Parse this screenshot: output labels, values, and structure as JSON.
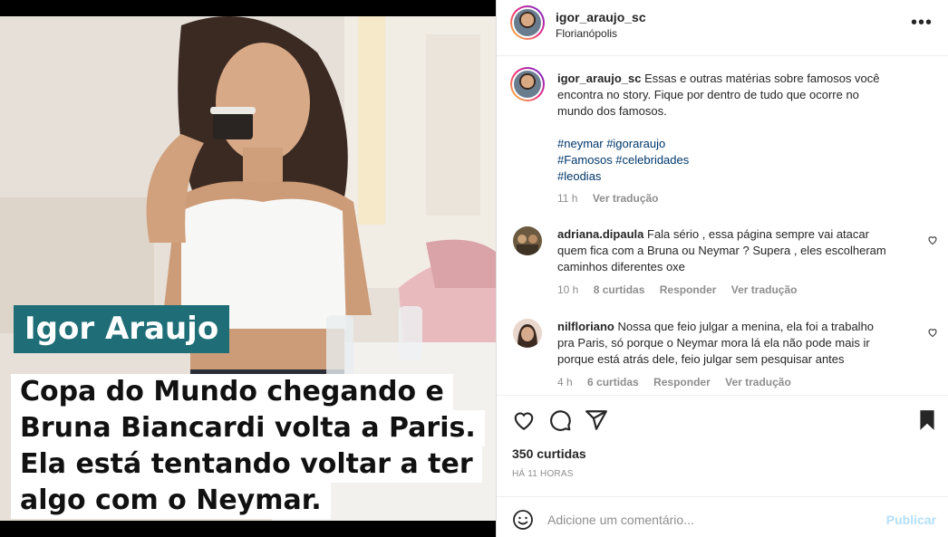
{
  "media": {
    "name_tag": "Igor Araujo",
    "caption_lines": [
      "Copa do Mundo chegando e",
      "Bruna Biancardi volta a Paris.",
      "Ela está tentando voltar a ter",
      "algo com o Neymar."
    ]
  },
  "header": {
    "username": "igor_araujo_sc",
    "location": "Florianópolis",
    "more_icon": "more-horizontal-icon"
  },
  "post_caption": {
    "username": "igor_araujo_sc",
    "text_lines": [
      "Essas e outras matérias sobre famosos você",
      "encontra no story. Fique por dentro de tudo que ocorre no",
      "mundo dos famosos."
    ],
    "hashtag_lines": [
      "#neymar #igoraraujo",
      "#Famosos #celebridades",
      "#leodias"
    ],
    "time": "11 h",
    "translate": "Ver tradução"
  },
  "comments": [
    {
      "username": "adriana.dipaula",
      "text_lines": [
        "Fala sério , essa página sempre vai atacar",
        "quem fica com a Bruna ou Neymar ? Supera , eles escolheram",
        "caminhos diferentes oxe"
      ],
      "time": "10 h",
      "likes": "8 curtidas",
      "reply": "Responder",
      "translate": "Ver tradução"
    },
    {
      "username": "nilfloriano",
      "text_lines": [
        "Nossa que feio julgar a menina, ela foi a trabalho",
        "pra Paris, só porque o Neymar mora lá ela não pode mais ir",
        "porque está atrás dele, feio julgar sem pesquisar antes"
      ],
      "time": "4 h",
      "likes": "6 curtidas",
      "reply": "Responder",
      "translate": "Ver tradução"
    }
  ],
  "actions": {
    "likes": "350 curtidas",
    "time_ago": "HÁ 11 HORAS",
    "icons": [
      "heart-icon",
      "comment-icon",
      "share-icon",
      "bookmark-icon"
    ]
  },
  "add_comment": {
    "placeholder": "Adicione um comentário...",
    "publish": "Publicar",
    "emoji_icon": "emoji-icon"
  },
  "colors": {
    "name_tag_bg": "#1f6e77",
    "hashtag": "#00376b",
    "publish_disabled": "#b2dffc",
    "meta_gray": "#8e8e8e"
  }
}
